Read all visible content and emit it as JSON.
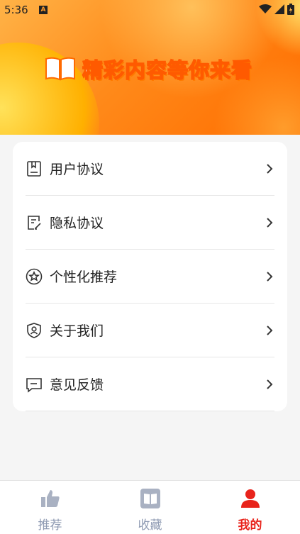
{
  "status_bar": {
    "time": "5:36",
    "notification_icon": "a-icon",
    "battery_icon": "battery-icon",
    "signal_icon": "signal-icon",
    "wifi_icon": "wifi-icon"
  },
  "banner": {
    "text": "精彩内容等你来看",
    "icon": "book-icon"
  },
  "menu": {
    "items": [
      {
        "label": "用户协议",
        "icon": "bookmark-doc-icon"
      },
      {
        "label": "隐私协议",
        "icon": "edit-doc-icon"
      },
      {
        "label": "个性化推荐",
        "icon": "star-circle-icon"
      },
      {
        "label": "关于我们",
        "icon": "shield-user-icon"
      },
      {
        "label": "意见反馈",
        "icon": "chat-icon"
      }
    ]
  },
  "tabbar": {
    "tabs": [
      {
        "label": "推荐",
        "icon": "thumbs-up-icon",
        "active": false
      },
      {
        "label": "收藏",
        "icon": "book-icon",
        "active": false
      },
      {
        "label": "我的",
        "icon": "user-icon",
        "active": true
      }
    ]
  },
  "colors": {
    "accent": "#e8231b",
    "hero_orange": "#ff8a1a",
    "inactive": "#8f9bb3"
  }
}
